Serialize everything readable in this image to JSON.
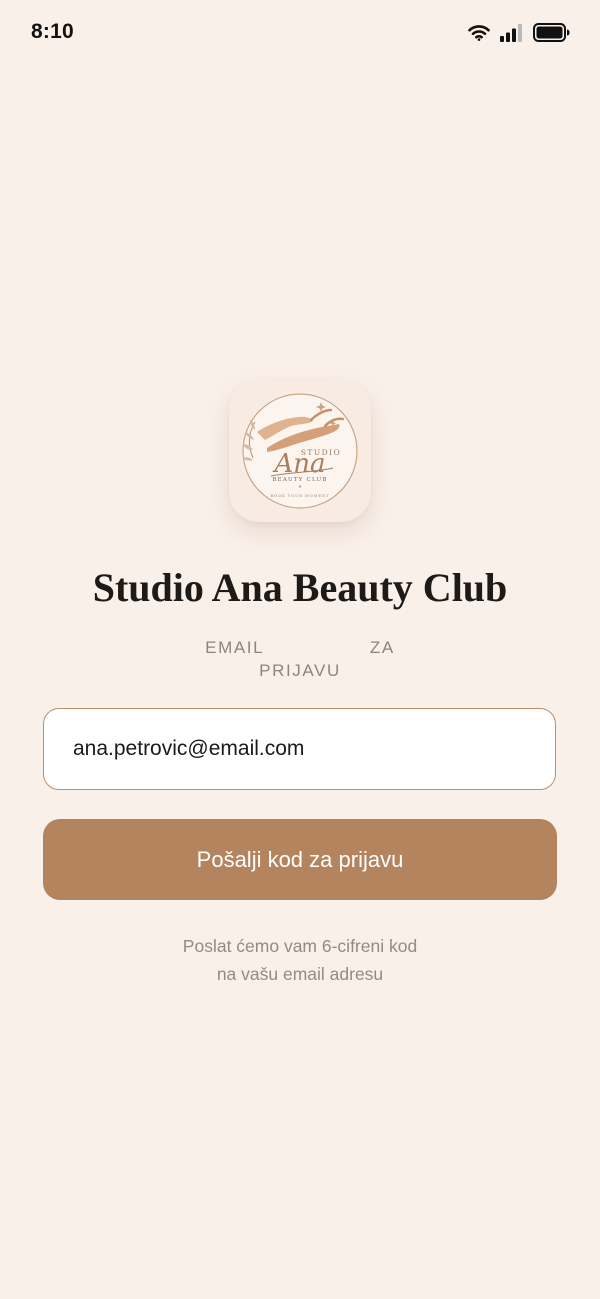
{
  "status_bar": {
    "time": "8:10",
    "icons": [
      "wifi-icon",
      "signal-icon",
      "battery-icon"
    ]
  },
  "logo": {
    "icon": "studio-ana-logo",
    "studio_text": "STUDIO",
    "name_text": "Ana",
    "subtitle_text": "BEAUTY CLUB",
    "tagline_text": "BOOK YOUR MOMENT"
  },
  "header": {
    "title": "Studio Ana Beauty Club"
  },
  "form": {
    "email_label_line1": "EMAIL ZA",
    "email_label_line2": "PRIJAVU",
    "email_value": "ana.petrovic@email.com",
    "submit_label": "Pošalji kod za prijavu",
    "helper_line1": "Poslat ćemo vam 6-cifreni kod",
    "helper_line2": "na vašu email adresu"
  },
  "colors": {
    "background": "#f9f0ea",
    "accent": "#b3845d",
    "field_border": "#b9906c",
    "muted_text": "#8b8581"
  }
}
